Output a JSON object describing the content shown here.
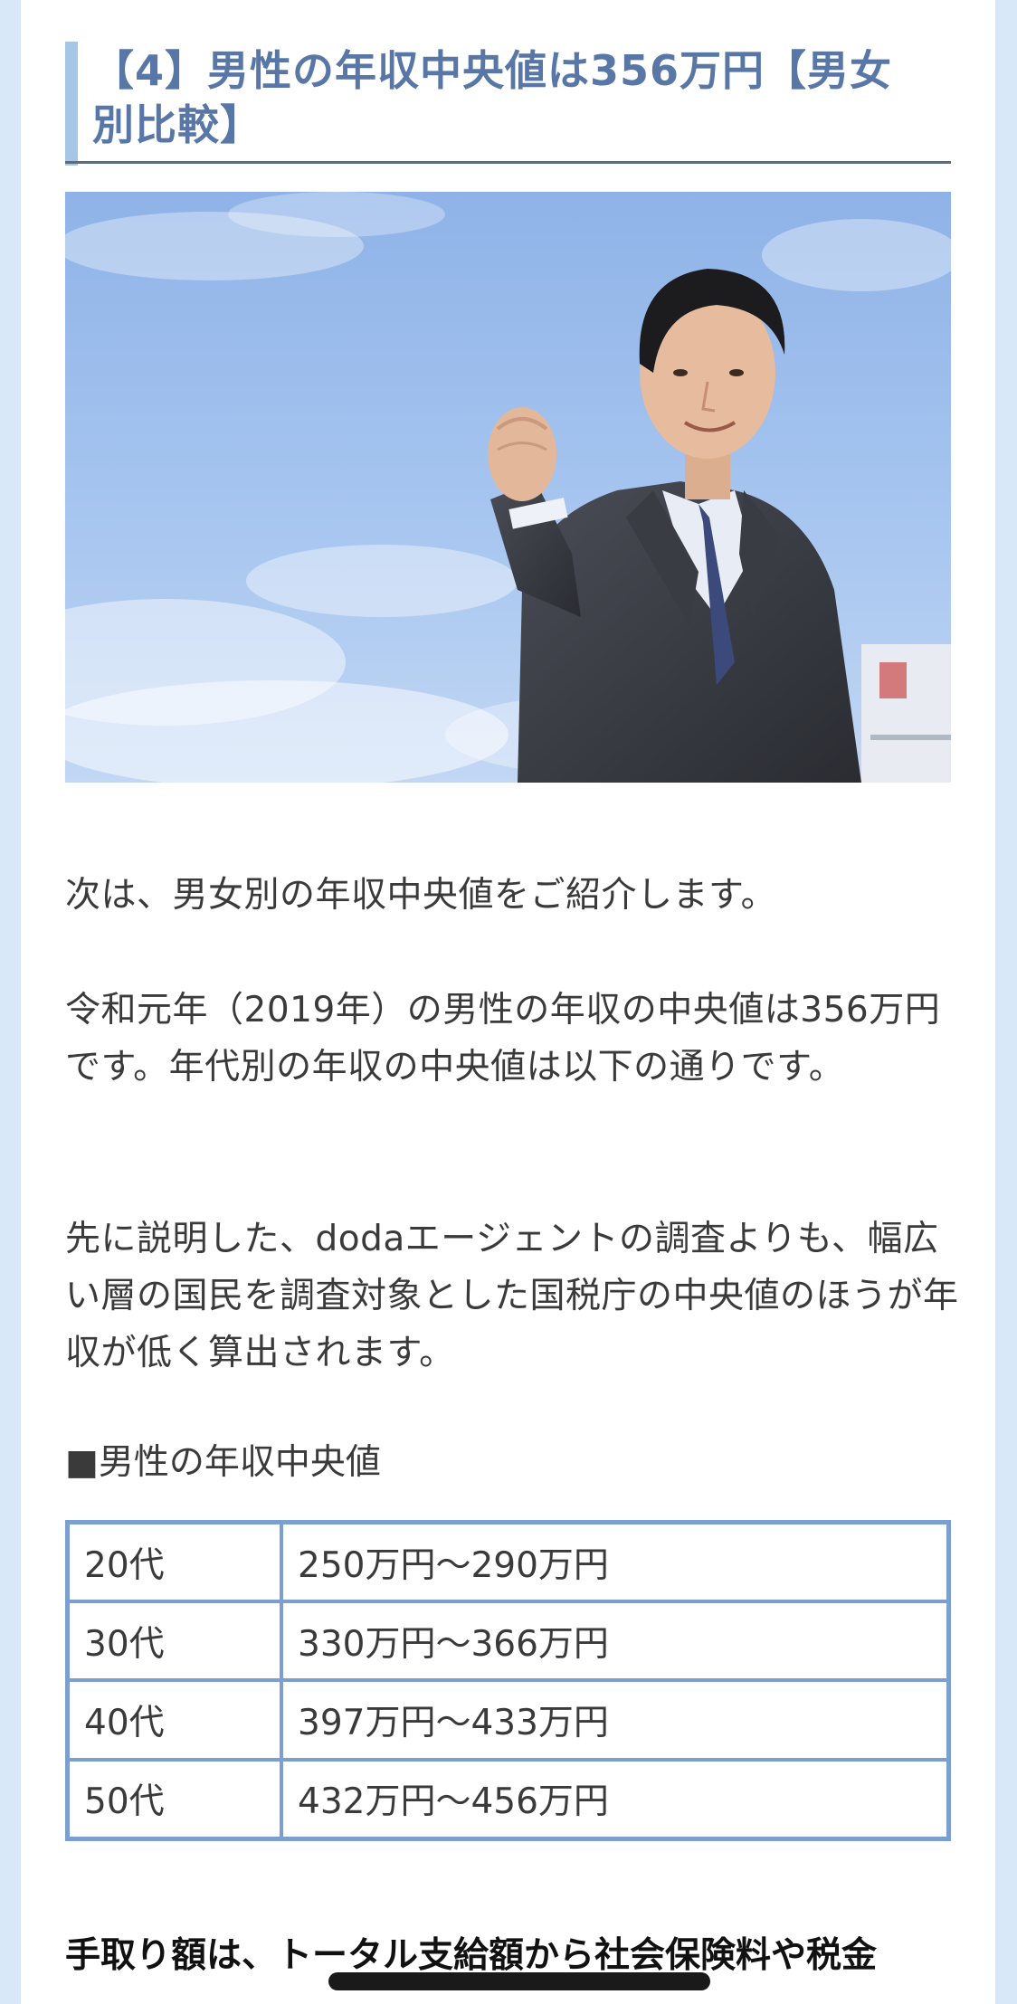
{
  "heading": "【4】男性の年収中央値は356万円【男女別比較】",
  "hero_image": {
    "icon": "businessman-fist-pump-photo",
    "colors": {
      "sky": "#9ec0ee",
      "suit": "#3a3d45"
    }
  },
  "paragraphs": [
    "次は、男女別の年収中央値をご紹介します。",
    "令和元年（2019年）の男性の年収の中央値は356万円です。年代別の年収の中央値は以下の通りです。",
    "先に説明した、dodaエージェントの調査よりも、幅広い層の国民を調査対象とした国税庁の中央値のほうが年収が低く算出されます。"
  ],
  "table": {
    "title": "■男性の年収中央値",
    "rows": [
      {
        "age": "20代",
        "range": "250万円～290万円"
      },
      {
        "age": "30代",
        "range": "330万円～366万円"
      },
      {
        "age": "40代",
        "range": "397万円～433万円"
      },
      {
        "age": "50代",
        "range": "432万円～456万円"
      }
    ]
  },
  "bold_paragraph": "手取り額は、トータル支給額から社会保険料や税金"
}
